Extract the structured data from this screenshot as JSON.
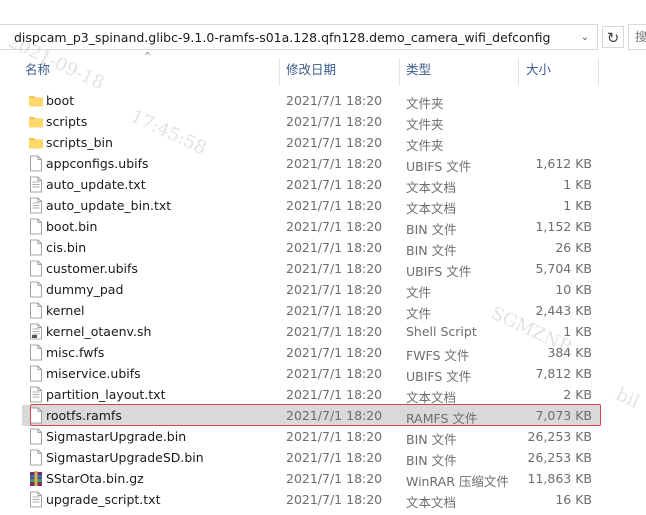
{
  "address_bar": {
    "path": "dispcam_p3_spinand.glibc-9.1.0-ramfs-s01a.128.qfn128.demo_camera_wifi_defconfig",
    "dropdown_icon": "chevron-down-icon",
    "refresh_icon": "refresh-icon",
    "search_placeholder": "搜"
  },
  "columns": {
    "name": "名称",
    "date": "修改日期",
    "type": "类型",
    "size": "大小"
  },
  "files": [
    {
      "name": "boot",
      "date": "2021/7/1 18:20",
      "type": "文件夹",
      "size": "",
      "icon": "folder-icon"
    },
    {
      "name": "scripts",
      "date": "2021/7/1 18:20",
      "type": "文件夹",
      "size": "",
      "icon": "folder-icon"
    },
    {
      "name": "scripts_bin",
      "date": "2021/7/1 18:20",
      "type": "文件夹",
      "size": "",
      "icon": "folder-icon"
    },
    {
      "name": "appconfigs.ubifs",
      "date": "2021/7/1 18:20",
      "type": "UBIFS 文件",
      "size": "1,612 KB",
      "icon": "file-icon"
    },
    {
      "name": "auto_update.txt",
      "date": "2021/7/1 18:20",
      "type": "文本文档",
      "size": "1 KB",
      "icon": "text-file-icon"
    },
    {
      "name": "auto_update_bin.txt",
      "date": "2021/7/1 18:20",
      "type": "文本文档",
      "size": "1 KB",
      "icon": "text-file-icon"
    },
    {
      "name": "boot.bin",
      "date": "2021/7/1 18:20",
      "type": "BIN 文件",
      "size": "1,152 KB",
      "icon": "file-icon"
    },
    {
      "name": "cis.bin",
      "date": "2021/7/1 18:20",
      "type": "BIN 文件",
      "size": "26 KB",
      "icon": "file-icon"
    },
    {
      "name": "customer.ubifs",
      "date": "2021/7/1 18:20",
      "type": "UBIFS 文件",
      "size": "5,704 KB",
      "icon": "file-icon"
    },
    {
      "name": "dummy_pad",
      "date": "2021/7/1 18:20",
      "type": "文件",
      "size": "10 KB",
      "icon": "file-icon"
    },
    {
      "name": "kernel",
      "date": "2021/7/1 18:20",
      "type": "文件",
      "size": "2,443 KB",
      "icon": "file-icon"
    },
    {
      "name": "kernel_otaenv.sh",
      "date": "2021/7/1 18:20",
      "type": "Shell Script",
      "size": "1 KB",
      "icon": "script-file-icon"
    },
    {
      "name": "misc.fwfs",
      "date": "2021/7/1 18:20",
      "type": "FWFS 文件",
      "size": "384 KB",
      "icon": "file-icon"
    },
    {
      "name": "miservice.ubifs",
      "date": "2021/7/1 18:20",
      "type": "UBIFS 文件",
      "size": "7,812 KB",
      "icon": "file-icon"
    },
    {
      "name": "partition_layout.txt",
      "date": "2021/7/1 18:20",
      "type": "文本文档",
      "size": "2 KB",
      "icon": "text-file-icon"
    },
    {
      "name": "rootfs.ramfs",
      "date": "2021/7/1 18:20",
      "type": "RAMFS 文件",
      "size": "7,073 KB",
      "icon": "file-icon",
      "selected": true
    },
    {
      "name": "SigmastarUpgrade.bin",
      "date": "2021/7/1 18:20",
      "type": "BIN 文件",
      "size": "26,253 KB",
      "icon": "file-icon"
    },
    {
      "name": "SigmastarUpgradeSD.bin",
      "date": "2021/7/1 18:20",
      "type": "BIN 文件",
      "size": "26,253 KB",
      "icon": "file-icon"
    },
    {
      "name": "SStarOta.bin.gz",
      "date": "2021/7/1 18:20",
      "type": "WinRAR 压缩文件",
      "size": "11,863 KB",
      "icon": "winrar-archive-icon"
    },
    {
      "name": "upgrade_script.txt",
      "date": "2021/7/1 18:20",
      "type": "文本文档",
      "size": "16 KB",
      "icon": "text-file-icon"
    }
  ],
  "colors": {
    "selected_row": "#d9d9d9",
    "highlight_border": "#d6434b",
    "header_text": "#3c5b8c",
    "folder": "#f4c55a"
  },
  "watermark": {
    "date": "2021-09-18",
    "time": "17:45:58",
    "brand": "SGMZNB",
    "extra": "bil"
  }
}
